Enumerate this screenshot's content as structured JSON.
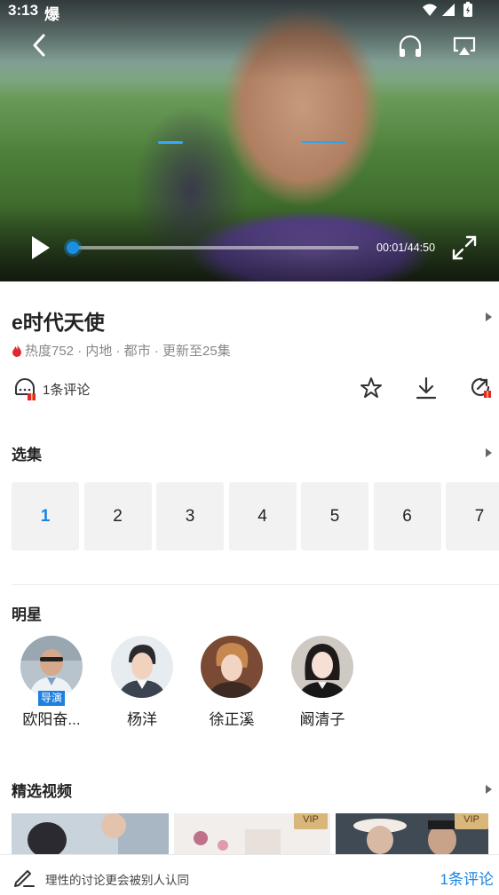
{
  "status_bar": {
    "time": "3:13",
    "carrier_glyph": "爆"
  },
  "player": {
    "current_time": "00:01",
    "duration": "44:50",
    "time_readout": "00:01/44:50",
    "progress_fraction": 0.0004
  },
  "show": {
    "title": "e时代天使",
    "meta": "热度752 · 内地 · 都市 · 更新至25集"
  },
  "actions": {
    "comment_label": "1条评论"
  },
  "episodes": {
    "section_title": "选集",
    "items": [
      "1",
      "2",
      "3",
      "4",
      "5",
      "6",
      "7"
    ],
    "selected_index": 0
  },
  "stars": {
    "section_title": "明星",
    "items": [
      {
        "name": "欧阳奋...",
        "badge": "导演"
      },
      {
        "name": "杨洋",
        "badge": ""
      },
      {
        "name": "徐正溪",
        "badge": ""
      },
      {
        "name": "阚清子",
        "badge": ""
      }
    ]
  },
  "featured": {
    "section_title": "精选视频",
    "badges": [
      "VIP",
      "VIP"
    ]
  },
  "bottom_bar": {
    "placeholder": "理性的讨论更会被别人认同",
    "comment_count": "1条评论"
  },
  "colors": {
    "accent": "#1b84e0",
    "vip": "#d9b77a",
    "fire": "#e0282e"
  }
}
